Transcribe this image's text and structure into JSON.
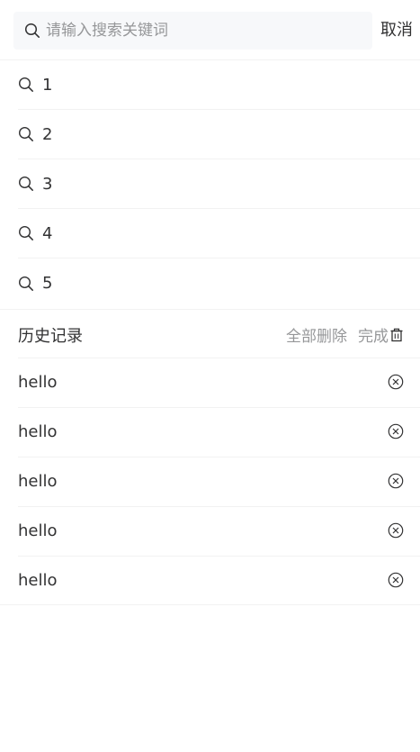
{
  "search": {
    "placeholder": "请输入搜索关键词",
    "value": "",
    "cancel_label": "取消"
  },
  "suggestions": [
    {
      "label": "1",
      "icon": "search-icon"
    },
    {
      "label": "2",
      "icon": "search-icon"
    },
    {
      "label": "3",
      "icon": "search-icon"
    },
    {
      "label": "4",
      "icon": "search-icon"
    },
    {
      "label": "5",
      "icon": "search-icon"
    }
  ],
  "history": {
    "title": "历史记录",
    "delete_all_label": "全部删除",
    "done_label": "完成",
    "trash_icon": "trash-icon",
    "items": [
      {
        "label": "hello",
        "icon": "close-circle-icon"
      },
      {
        "label": "hello",
        "icon": "close-circle-icon"
      },
      {
        "label": "hello",
        "icon": "close-circle-icon"
      },
      {
        "label": "hello",
        "icon": "close-circle-icon"
      },
      {
        "label": "hello",
        "icon": "close-circle-icon"
      }
    ]
  },
  "colors": {
    "text": "#323233",
    "muted": "#969799",
    "divider": "#f2f2f2",
    "input_bg": "#f7f8fa"
  }
}
